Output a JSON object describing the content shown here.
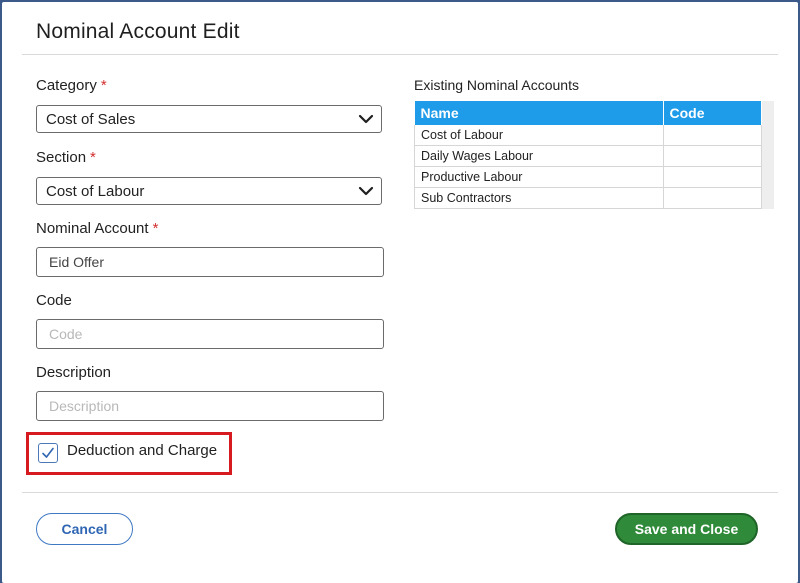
{
  "dialog": {
    "title": "Nominal Account Edit"
  },
  "form": {
    "required_marker": "*",
    "category": {
      "label": "Category",
      "value": "Cost of Sales"
    },
    "section": {
      "label": "Section",
      "value": "Cost of Labour"
    },
    "nominal_account": {
      "label": "Nominal Account",
      "value": "Eid Offer"
    },
    "code": {
      "label": "Code",
      "value": "",
      "placeholder": "Code"
    },
    "description": {
      "label": "Description",
      "value": "",
      "placeholder": "Description"
    },
    "deduction": {
      "label": "Deduction and Charge",
      "checked": true
    }
  },
  "existing": {
    "title": "Existing Nominal Accounts",
    "columns": [
      "Name",
      "Code"
    ],
    "rows": [
      [
        "Cost of Labour",
        ""
      ],
      [
        "Daily Wages Labour",
        ""
      ],
      [
        "Productive Labour",
        ""
      ],
      [
        "Sub Contractors",
        ""
      ]
    ]
  },
  "buttons": {
    "cancel": "Cancel",
    "save": "Save and Close"
  },
  "colors": {
    "header_blue": "#1e9be9",
    "required_red": "#d32f2f",
    "highlight_red": "#d71920",
    "save_green": "#2f8a3a",
    "cancel_blue": "#2f66b3"
  }
}
